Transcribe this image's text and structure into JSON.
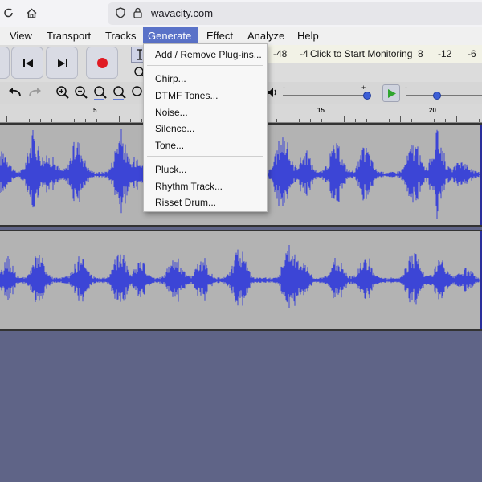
{
  "browser": {
    "url": "wavacity.com"
  },
  "menubar": [
    {
      "label": "View",
      "active": false
    },
    {
      "label": "Transport",
      "active": false
    },
    {
      "label": "Tracks",
      "active": false
    },
    {
      "label": "Generate",
      "active": true
    },
    {
      "label": "Effect",
      "active": false
    },
    {
      "label": "Analyze",
      "active": false
    },
    {
      "label": "Help",
      "active": false
    }
  ],
  "meter": {
    "labels": [
      "-48",
      "-4",
      "8",
      "-12",
      "-6"
    ],
    "monitor_label": "Click to Start Monitoring"
  },
  "ruler": {
    "labels": [
      "5",
      "15",
      "20"
    ]
  },
  "generate_menu": {
    "items": [
      "Add / Remove Plug-ins...",
      "Chirp...",
      "DTMF Tones...",
      "Noise...",
      "Silence...",
      "Tone...",
      "Pluck...",
      "Rhythm Track...",
      "Risset Drum..."
    ]
  },
  "sliders": {
    "left_plus": "+",
    "right_minus": "-",
    "left_minus": "-"
  },
  "colors": {
    "accent": "#5a72c8",
    "waveform": "#3c45d6",
    "track_bg": "#b3b3b3",
    "page_bg": "#5f6487",
    "record": "#e01b24",
    "play": "#2fa52f"
  }
}
